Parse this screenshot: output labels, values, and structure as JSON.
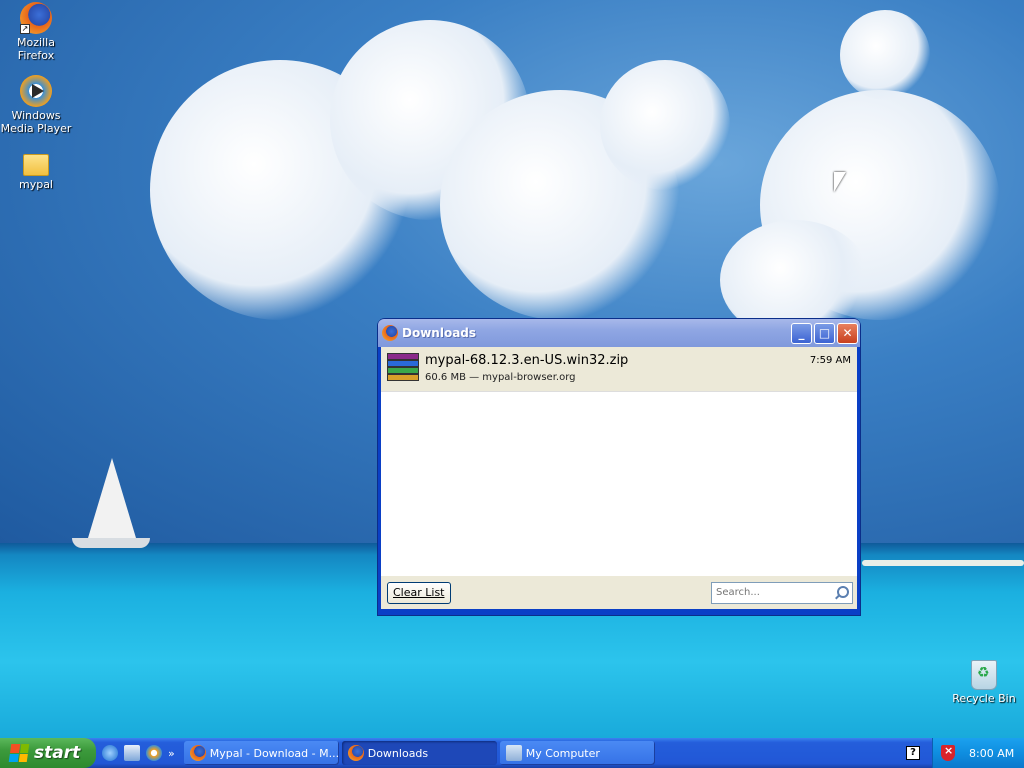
{
  "desktop": {
    "icons": [
      {
        "label": "Mozilla Firefox",
        "icon": "firefox-icon"
      },
      {
        "label": "Windows Media Player",
        "icon": "media-player-icon"
      },
      {
        "label": "mypal",
        "icon": "folder-icon"
      },
      {
        "label": "Recycle Bin",
        "icon": "recycle-bin-icon"
      }
    ]
  },
  "window": {
    "title": "Downloads",
    "download": {
      "filename": "mypal-68.12.3.en-US.win32.zip",
      "status": "60.6 MB — mypal-browser.org",
      "time": "7:59 AM",
      "icon": "winrar-archive-icon"
    },
    "clear_button": "Clear List",
    "search_placeholder": "Search..."
  },
  "taskbar": {
    "start_label": "start",
    "quick_launch_more": "»",
    "tasks": [
      {
        "label": "Mypal - Download - M...",
        "icon": "firefox-icon",
        "active": false
      },
      {
        "label": "Downloads",
        "icon": "firefox-icon",
        "active": true
      },
      {
        "label": "My Computer",
        "icon": "computer-icon",
        "active": false
      }
    ],
    "clock": "8:00 AM"
  }
}
